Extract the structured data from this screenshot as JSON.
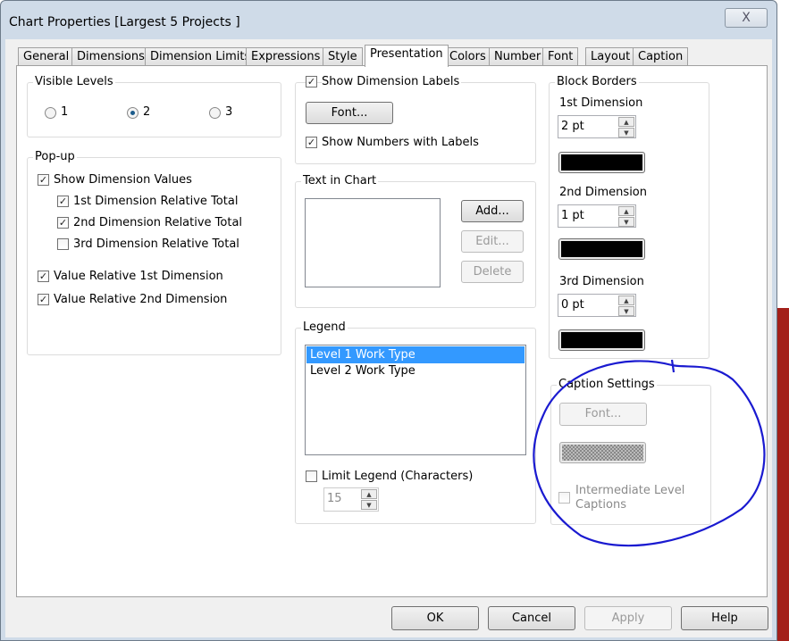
{
  "window": {
    "title": "Chart Properties [Largest 5 Projects ]",
    "close_label": "X"
  },
  "tabs": [
    "General",
    "Dimensions",
    "Dimension Limits",
    "Expressions",
    "Style",
    "Presentation",
    "Colors",
    "Number",
    "Font",
    "Layout",
    "Caption"
  ],
  "active_tab": "Presentation",
  "visible_levels": {
    "label": "Visible Levels",
    "options": [
      "1",
      "2",
      "3"
    ],
    "selected": "2"
  },
  "popup": {
    "label": "Pop-up",
    "show_dimension_values": {
      "label": "Show Dimension Values",
      "checked": true
    },
    "items": [
      {
        "label": "1st Dimension Relative Total",
        "checked": true
      },
      {
        "label": "2nd Dimension Relative Total",
        "checked": true
      },
      {
        "label": "3rd Dimension Relative Total",
        "checked": false
      }
    ],
    "value_rel_1": {
      "label": "Value Relative 1st Dimension",
      "checked": true
    },
    "value_rel_2": {
      "label": "Value Relative 2nd Dimension",
      "checked": true
    }
  },
  "dimension_labels": {
    "show_label": "Show Dimension Labels",
    "show_checked": true,
    "font_button": "Font...",
    "numbers_label": "Show Numbers with Labels",
    "numbers_checked": true
  },
  "text_in_chart": {
    "label": "Text in Chart",
    "add": "Add...",
    "edit": "Edit...",
    "delete": "Delete"
  },
  "legend": {
    "label": "Legend",
    "items": [
      "Level 1 Work Type",
      "Level 2 Work Type"
    ],
    "selected": "Level 1 Work Type",
    "limit_label": "Limit Legend (Characters)",
    "limit_checked": false,
    "limit_value": "15"
  },
  "block_borders": {
    "label": "Block Borders",
    "dims": [
      {
        "label": "1st Dimension",
        "value": "2 pt",
        "color": "#000000"
      },
      {
        "label": "2nd Dimension",
        "value": "1 pt",
        "color": "#000000"
      },
      {
        "label": "3rd Dimension",
        "value": "0 pt",
        "color": "#000000"
      }
    ]
  },
  "caption_settings": {
    "label": "Caption Settings",
    "font_button": "Font...",
    "intermediate_label_1": "Intermediate Level",
    "intermediate_label_2": "Captions",
    "intermediate_checked": false
  },
  "footer": {
    "ok": "OK",
    "cancel": "Cancel",
    "apply": "Apply",
    "help": "Help"
  },
  "annotation_color": "#1a1ad0"
}
